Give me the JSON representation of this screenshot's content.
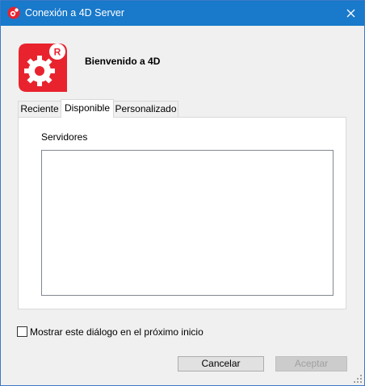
{
  "window": {
    "title": "Conexión a 4D Server"
  },
  "header": {
    "welcome": "Bienvenido a 4D"
  },
  "tabs": [
    {
      "label": "Reciente"
    },
    {
      "label": "Disponible"
    },
    {
      "label": "Personalizado"
    }
  ],
  "panel": {
    "servers_label": "Servidores",
    "servers": []
  },
  "footer": {
    "show_next_label": "Mostrar este diálogo en el próximo inicio",
    "show_next_checked": false,
    "cancel_label": "Cancelar",
    "accept_label": "Aceptar"
  },
  "colors": {
    "titlebar": "#1979ca",
    "brand_red": "#e8232e"
  },
  "icons": [
    "4d-app-icon",
    "close-icon",
    "4d-logo-icon",
    "resize-grip-icon"
  ]
}
